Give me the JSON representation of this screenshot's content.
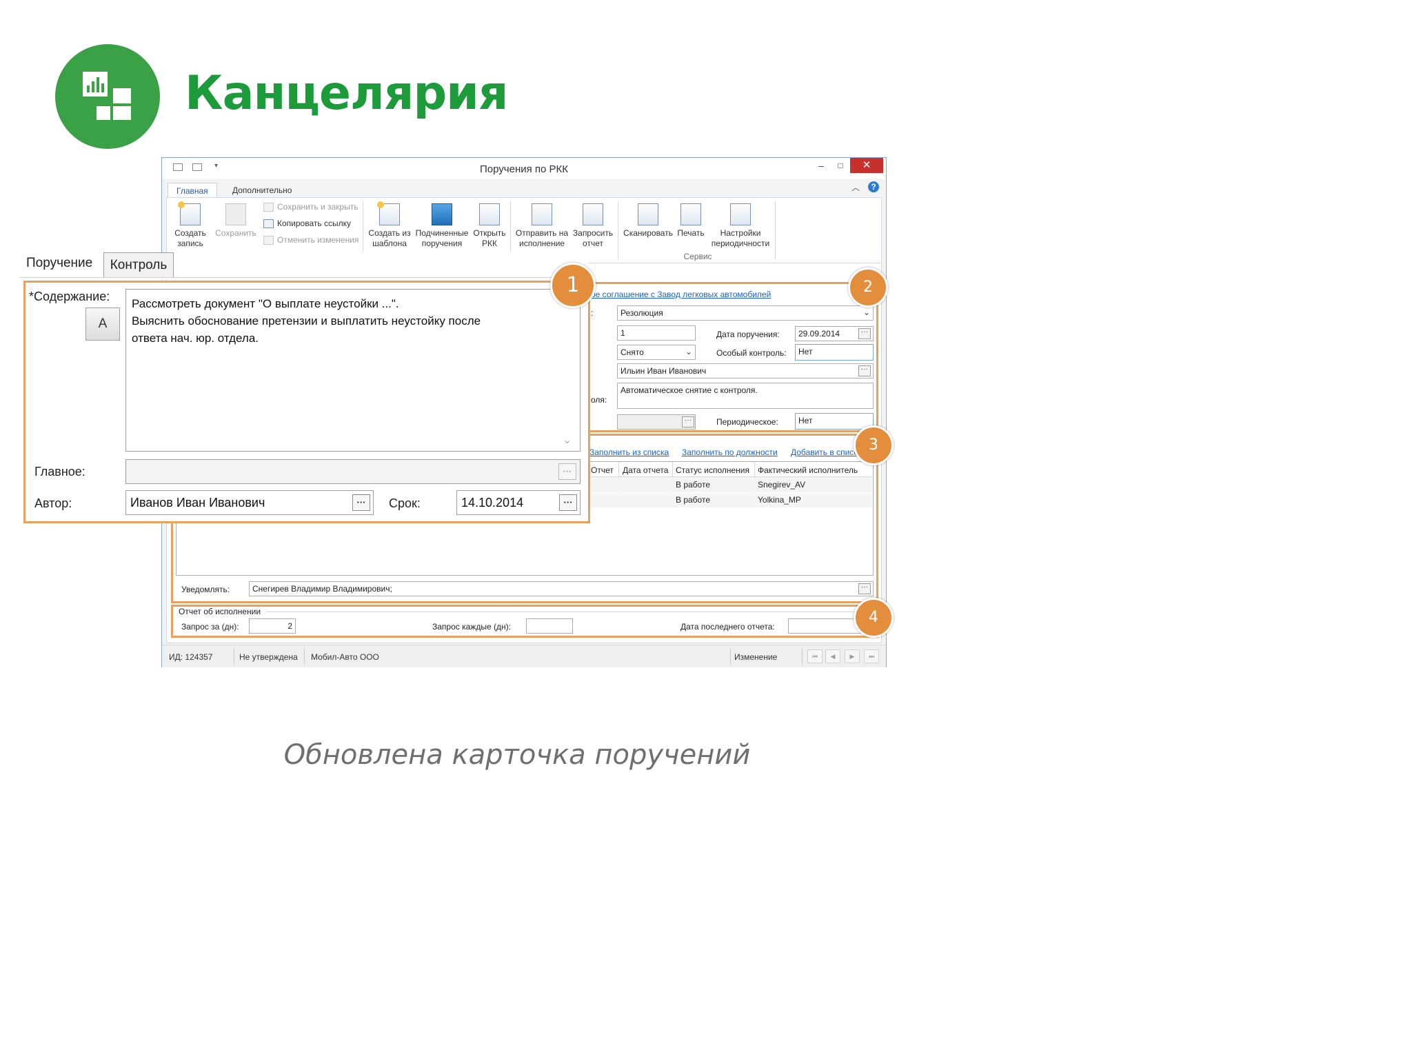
{
  "slide": {
    "title": "Канцелярия",
    "caption": "Обновлена карточка поручений",
    "accent_color": "#3aa147",
    "logo_icon": "bar-chart-tiles-icon"
  },
  "window": {
    "title": "Поручения по РКК",
    "controls": {
      "minimize": "–",
      "maximize": "□",
      "close": "✕"
    },
    "ribbon_tabs": [
      "Главная",
      "Дополнительно"
    ],
    "ribbon": {
      "create_record": "Создать запись",
      "save": "Сохранить",
      "save_close": "Сохранить и закрыть",
      "copy_link": "Копировать ссылку",
      "cancel_changes": "Отменить изменения",
      "create_from_template": "Создать из шаблона",
      "sub_orders": "Подчиненные поручения",
      "open_rkk": "Открыть РКК",
      "send_to_exec": "Отправить на исполнение",
      "request_report": "Запросить отчет",
      "scan": "Сканировать",
      "print": "Печать",
      "periodicity_settings": "Настройки периодичности",
      "service_group": "Сервис"
    },
    "form": {
      "link_text": "ое соглашение с Завод легковых автомобилей",
      "type_value": "Резолюция",
      "colon_label": ":",
      "number_value": "1",
      "order_date_label": "Дата поручения:",
      "order_date_value": "29.09.2014",
      "status_value": "Снято",
      "special_control_label": "Особый контроль:",
      "special_control_value": "Нет",
      "controller_value": "Ильин Иван Иванович",
      "control_partial_label": "оля:",
      "control_note": "Автоматическое снятие с контроля.",
      "periodic_label": "Периодическое:",
      "periodic_value": "Нет"
    },
    "executors": {
      "fill_from_list": "Заполнить из списка",
      "fill_by_position": "Заполнить по должности",
      "add_to_list": "Добавить в список",
      "columns": [
        "Отчет",
        "Дата отчета",
        "Статус исполнения",
        "Фактический исполнитель"
      ],
      "rows": [
        {
          "report": "",
          "report_date": "",
          "status": "В работе",
          "actual": "Snegirev_AV"
        },
        {
          "report": "",
          "report_date": "",
          "status": "В работе",
          "actual": "Yolkina_MP"
        }
      ],
      "notify_label": "Уведомлять:",
      "notify_value": "Снегирев Владимир Владимирович;"
    },
    "report_section": {
      "title": "Отчет об исполнении",
      "request_for_label": "Запрос за (дн):",
      "request_for_value": "2",
      "request_every_label": "Запрос каждые (дн):",
      "request_every_value": "",
      "last_report_label": "Дата последнего отчета:",
      "last_report_value": ""
    },
    "statusbar": {
      "id_text": "ИД: 124357",
      "approval": "Не утверждена",
      "org": "Мобил-Авто ООО",
      "mode": "Изменение",
      "nav": [
        "⏮",
        "◀",
        "▶",
        "⏭"
      ]
    }
  },
  "overlay": {
    "tabs": [
      "Поручение",
      "Контроль"
    ],
    "content_label": "*Содержание:",
    "content_lines": [
      "Рассмотреть документ \"О выплате неустойки ...\".",
      "Выяснить обоснование претензии и выплатить неустойку после",
      "ответа нач. юр. отдела."
    ],
    "a_button": "A",
    "main_label": "Главное:",
    "main_value": "",
    "author_label": "Автор:",
    "author_value": "Иванов Иван Иванович",
    "deadline_label": "Срок:",
    "deadline_value": "14.10.2014",
    "dots": "···"
  },
  "badges": [
    "1",
    "2",
    "3",
    "4"
  ],
  "colors": {
    "highlight": "#e8a15e",
    "badge": "#e38e3d",
    "title_green": "#1d9b3a",
    "link": "#1c63c2"
  }
}
